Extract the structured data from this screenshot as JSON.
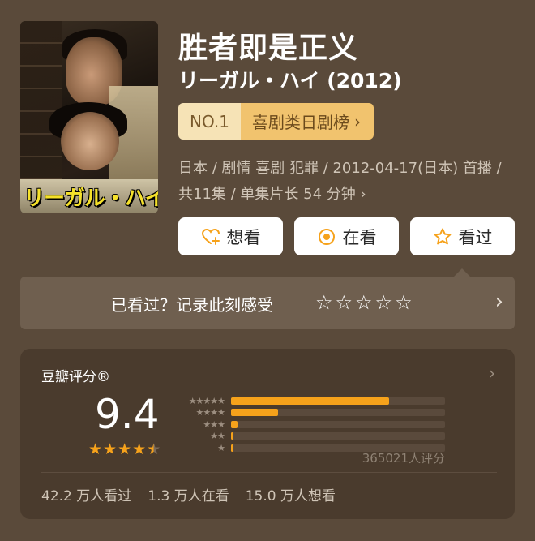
{
  "movie": {
    "title": "胜者即是正义",
    "subtitle": "リーガル・ハイ (2012)",
    "poster_title": "リーガル・ハイ"
  },
  "rank": {
    "number": "NO.1",
    "category": "喜剧类日剧榜",
    "chevron": "›"
  },
  "meta": {
    "line1": "日本 / 剧情 喜剧 犯罪 / 2012-04-17(日本) 首播 /",
    "line2": "共11集 / 单集片长 54 分钟",
    "chevron": "›"
  },
  "actions": {
    "want_label": "想看",
    "watching_label": "在看",
    "watched_label": "看过"
  },
  "record": {
    "prompt": "已看过？记录此刻感受",
    "chevron": "›"
  },
  "rating": {
    "label": "豆瓣评分®",
    "score": "9.4",
    "total": "365021人评分",
    "distribution": [
      {
        "stars": "★★★★★",
        "percent": 74
      },
      {
        "stars": "★★★★",
        "percent": 22
      },
      {
        "stars": "★★★",
        "percent": 3
      },
      {
        "stars": "★★",
        "percent": 1
      },
      {
        "stars": "★",
        "percent": 1
      }
    ],
    "stars_display": 4.5
  },
  "stats": {
    "watched": "42.2 万人看过",
    "watching": "1.3 万人在看",
    "want": "15.0 万人想看"
  },
  "colors": {
    "background": "#5a4a3a",
    "accent": "#f6a21b",
    "rank_badge": "#f1c36e"
  }
}
